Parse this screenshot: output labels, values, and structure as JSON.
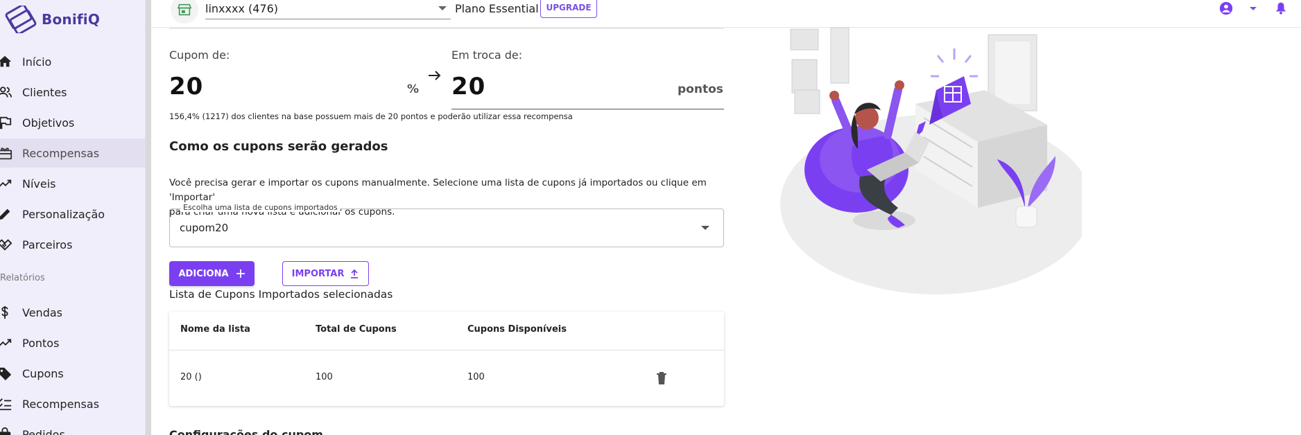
{
  "app": {
    "brand": "BonifiQ",
    "brand_color": "#4a3aa0",
    "accent": "#7b3ff2"
  },
  "sidebar": {
    "items": [
      {
        "label": "Início",
        "icon": "home-icon"
      },
      {
        "label": "Clientes",
        "icon": "users-icon"
      },
      {
        "label": "Objetivos",
        "icon": "flag-icon"
      },
      {
        "label": "Recompensas",
        "icon": "gift-icon",
        "active": true
      },
      {
        "label": "Níveis",
        "icon": "trending-icon"
      },
      {
        "label": "Personalização",
        "icon": "pencil-icon"
      },
      {
        "label": "Parceiros",
        "icon": "handshake-icon"
      }
    ],
    "section_reports": "Relatórios",
    "report_items": [
      {
        "label": "Vendas",
        "icon": "dollar-icon"
      },
      {
        "label": "Pontos",
        "icon": "trending-icon"
      },
      {
        "label": "Cupons",
        "icon": "tag-icon"
      },
      {
        "label": "Recompensas",
        "icon": "checklist-icon"
      },
      {
        "label": "Pedidos",
        "icon": "bag-icon"
      }
    ]
  },
  "topbar": {
    "store": "linxxxx (476)",
    "plan": "Plano Essential",
    "upgrade": "UPGRADE"
  },
  "coupon": {
    "label_left": "Cupom de:",
    "value_left": "20",
    "unit_left": "%",
    "label_right": "Em troca de:",
    "value_right": "20",
    "unit_right": "pontos",
    "hint": "156,4% (1217) dos clientes na base possuem mais de 20 pontos e poderão utilizar essa recompensa"
  },
  "generation": {
    "title": "Como os cupons serão gerados",
    "description_line1": "Você precisa gerar e importar os cupons manualmente. Selecione uma lista de cupons já importados ou clique em 'Importar'",
    "description_line2": "para criar uma nova lista e adicionar os cupons.",
    "select_legend": "Escolha uma lista de cupons importados",
    "select_value": "cupom20",
    "add_button": "ADICIONA",
    "import_button": "IMPORTAR"
  },
  "table": {
    "title": "Lista de Cupons Importados selecionadas",
    "headers": [
      "Nome da lista",
      "Total de Cupons",
      "Cupons Disponíveis"
    ],
    "rows": [
      [
        "20 ()",
        "100",
        "100"
      ]
    ]
  },
  "next_section": "Configurações do cupom"
}
